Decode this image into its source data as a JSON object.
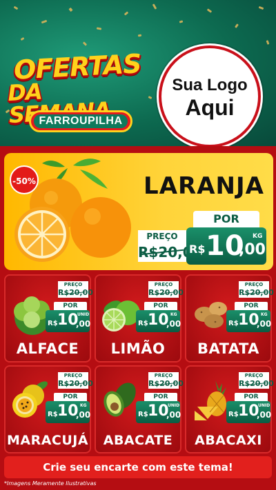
{
  "header": {
    "title_line1": "OFERTAS",
    "title_line2": "DA SEMANA",
    "subtitle": "FARROUPILHA",
    "logo_line1": "Sua Logo",
    "logo_line2": "Aqui"
  },
  "featured": {
    "discount_badge": "-50%",
    "name": "LARANJA",
    "old_price_label": "PREÇO",
    "old_price": "R$20,00",
    "new_price_label": "POR",
    "currency": "R$",
    "new_price_int": "10",
    "new_price_dec": ",00",
    "unit": "KG"
  },
  "products": [
    {
      "name": "ALFACE",
      "old_label": "PREÇO",
      "old_price": "R$20,00",
      "por_label": "POR",
      "currency": "R$",
      "price_int": "10",
      "price_dec": ",00",
      "unit": "UNID"
    },
    {
      "name": "LIMÃO",
      "old_label": "PREÇO",
      "old_price": "R$20,00",
      "por_label": "POR",
      "currency": "R$",
      "price_int": "10",
      "price_dec": ",00",
      "unit": "KG"
    },
    {
      "name": "BATATA",
      "old_label": "PREÇO",
      "old_price": "R$20,00",
      "por_label": "POR",
      "currency": "R$",
      "price_int": "10",
      "price_dec": ",00",
      "unit": "KG"
    },
    {
      "name": "MARACUJÁ",
      "old_label": "PREÇO",
      "old_price": "R$20,00",
      "por_label": "POR",
      "currency": "R$",
      "price_int": "10",
      "price_dec": ",00",
      "unit": "KG"
    },
    {
      "name": "ABACATE",
      "old_label": "PREÇO",
      "old_price": "R$20,00",
      "por_label": "POR",
      "currency": "R$",
      "price_int": "10",
      "price_dec": ",00",
      "unit": "UNID"
    },
    {
      "name": "ABACAXI",
      "old_label": "PREÇO",
      "old_price": "R$20,00",
      "por_label": "POR",
      "currency": "R$",
      "price_int": "10",
      "price_dec": ",00",
      "unit": "UNID"
    }
  ],
  "banner": {
    "text": "Crie seu encarte com este tema!"
  },
  "footnote": "*Imagens Meramente Ilustrativas",
  "colors": {
    "background": "#b50d12",
    "header_green": "#0d6a50",
    "accent_yellow": "#ffd21c",
    "price_green": "#0b5c43"
  }
}
